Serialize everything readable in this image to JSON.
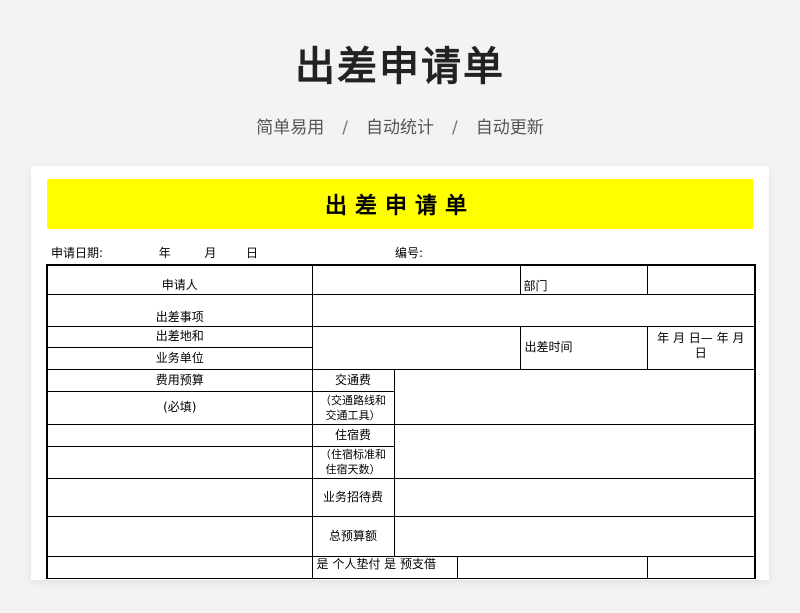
{
  "hero": {
    "title": "出差申请单",
    "tags": [
      "简单易用",
      "自动统计",
      "自动更新"
    ],
    "separator": "/"
  },
  "form": {
    "title": "出差申请单",
    "date_label": "申请日期:",
    "year": "年",
    "month": "月",
    "day": "日",
    "number_label": "编号:",
    "rows": {
      "applicant": "申请人",
      "department": "部门",
      "trip_matter": "出差事项",
      "trip_place": "出差地和",
      "business_unit": "业务单位",
      "trip_time": "出差时间",
      "trip_time_value_1": "年  月  日—       年  月",
      "trip_time_value_2": "日",
      "budget": "费用预算",
      "required": "(必填)",
      "transport_fee": "交通费",
      "transport_note_1": "（交通路线和",
      "transport_note_2": "交通工具）",
      "lodging_fee": "住宿费",
      "lodging_note_1": "（住宿标准和",
      "lodging_note_2": "住宿天数）",
      "entertain_fee": "业务招待费",
      "total_budget": "总预算额",
      "last_row_partial": "是  个人垫付  是  预支借"
    }
  }
}
